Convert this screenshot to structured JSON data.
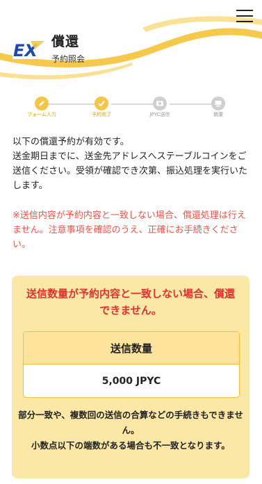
{
  "header": {
    "logo_text": "EX",
    "title": "償還",
    "subtitle": "予約照会",
    "menu_icon": "hamburger-menu-icon"
  },
  "steps": [
    {
      "label": "フォーム入力",
      "icon": "pencil-icon",
      "state": "done"
    },
    {
      "label": "予約完了",
      "icon": "check-icon",
      "state": "done"
    },
    {
      "label": "JPYC送信",
      "icon": "yen-coin-icon",
      "state": "pending"
    },
    {
      "label": "償還",
      "icon": "payout-icon",
      "state": "pending"
    }
  ],
  "intro": "以下の償還予約が有効です。\n送金期日までに、送金先アドレスへステーブルコインをご送信ください。受領が確認でき次第、振込処理を実行いたします。",
  "warning": "※送信内容が予約内容と一致しない場合、償還処理は行えません。注意事項を確認のうえ、正確にお手続きください。",
  "notice": {
    "heading": "送信数量が予約内容と一致しない場合、償還できません。",
    "box_title": "送信数量",
    "box_value": "5,000 JPYC",
    "footer": "部分一致や、複数回の送信の合算などの手続きもできません。\n小数点以下の端数がある場合も不一致となります。"
  },
  "colors": {
    "accent": "#f3c64a",
    "warning_text": "#e8544a",
    "notice_bg": "#fbe7a6",
    "brand_blue": "#1d4ba3"
  }
}
